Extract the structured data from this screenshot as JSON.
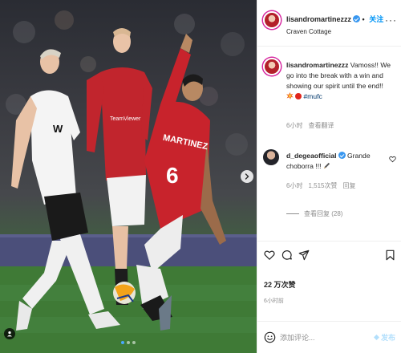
{
  "post": {
    "username": "lisandromartinezzz",
    "follow_label": "关注",
    "location": "Craven Cottage",
    "more_icon": "more-horizontal-icon"
  },
  "caption": {
    "username": "lisandromartinezzz",
    "text": "Vamoss!! We go into the break with a win and showing our spirit until the end!!",
    "emojis": [
      "collision-emoji",
      "red-circle-emoji"
    ],
    "hashtag": "#mufc",
    "time": "6小时",
    "translate_label": "查看翻译"
  },
  "comments": [
    {
      "username": "d_degeaofficial",
      "text": "Grande choborra !!!",
      "emoji": "pencil-emoji",
      "time": "6小时",
      "likes": "1,515次赞",
      "reply_label": "回复"
    }
  ],
  "replies": {
    "label": "查看回复 (28)"
  },
  "actions": {
    "icons": [
      "heart-icon",
      "comment-icon",
      "share-icon",
      "bookmark-icon"
    ],
    "likes_text": "22 万次赞",
    "time_text": "6小时前"
  },
  "comment_input": {
    "placeholder": "添加评论...",
    "post_label": "发布"
  },
  "photo": {
    "jersey_number": "6",
    "jersey_name": "MARTINEZ",
    "sponsor": "TeamViewer",
    "carousel": {
      "count": 3,
      "active": 1
    }
  },
  "colors": {
    "accent": "#0095f6",
    "verified": "#3897f0",
    "united_red": "#b3202a"
  }
}
